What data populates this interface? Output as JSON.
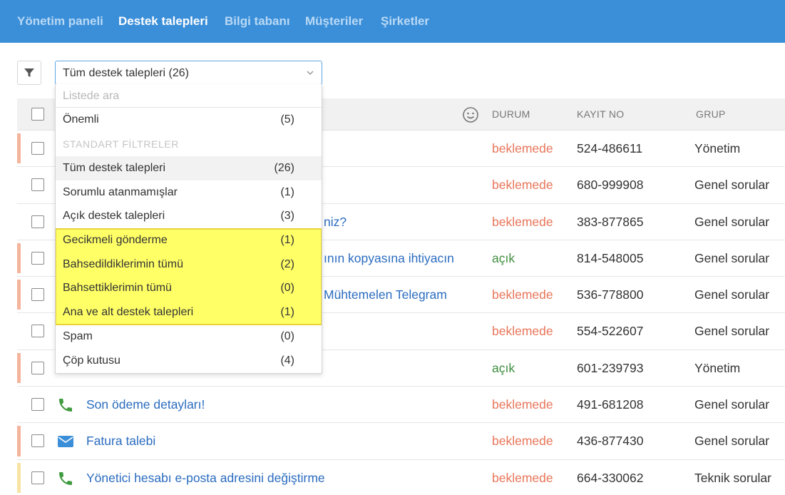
{
  "nav": {
    "items": [
      {
        "label": "Yönetim paneli"
      },
      {
        "label": "Destek talepleri"
      },
      {
        "label": "Bilgi tabanı"
      },
      {
        "label": "Müşteriler"
      },
      {
        "label": "Şirketler"
      }
    ],
    "active": "Destek talepleri"
  },
  "filter_button": {
    "icon": "funnel-icon"
  },
  "view_select": {
    "value": "Tüm destek talepleri (26)",
    "search_placeholder": "Listede ara",
    "section_label": "STANDART FİLTRELER",
    "items": [
      {
        "label": "Önemli",
        "count": "(5)"
      },
      {
        "label": "Tüm destek talepleri",
        "count": "(26)"
      },
      {
        "label": "Sorumlu atanmamışlar",
        "count": "(1)"
      },
      {
        "label": "Açık destek talepleri",
        "count": "(3)"
      },
      {
        "label": "Gecikmeli gönderme",
        "count": "(1)"
      },
      {
        "label": "Bahsedildiklerimin tümü",
        "count": "(2)"
      },
      {
        "label": "Bahsettiklerimin tümü",
        "count": "(0)"
      },
      {
        "label": "Ana ve alt destek talepleri",
        "count": "(1)"
      },
      {
        "label": "Spam",
        "count": "(0)"
      },
      {
        "label": "Çöp kutusu",
        "count": "(4)"
      }
    ]
  },
  "table": {
    "columns": {
      "status": "DURUM",
      "ticket_no": "KAYIT NO",
      "group": "GRUP"
    },
    "header_icon": "smiley-icon",
    "rows": [
      {
        "subject": "",
        "status": "beklemede",
        "ticket_no": "524-486611",
        "group": "Yönetim",
        "priority_color": "#f5b49c"
      },
      {
        "subject": "",
        "status": "beklemede",
        "ticket_no": "680-999908",
        "group": "Genel sorular",
        "priority_color": ""
      },
      {
        "subject": "niz?",
        "status": "beklemede",
        "ticket_no": "383-877865",
        "group": "Genel sorular",
        "priority_color": ""
      },
      {
        "subject": "ının kopyasına ihtiyacın",
        "status": "açık",
        "ticket_no": "814-548005",
        "group": "Genel sorular",
        "priority_color": "#f5b49c"
      },
      {
        "subject": "Mühtemelen Telegram",
        "status": "beklemede",
        "ticket_no": "536-778800",
        "group": "Genel sorular",
        "priority_color": "#f5b49c"
      },
      {
        "subject": "",
        "status": "beklemede",
        "ticket_no": "554-522607",
        "group": "Genel sorular",
        "priority_color": ""
      },
      {
        "subject": "",
        "status": "açık",
        "ticket_no": "601-239793",
        "group": "Yönetim",
        "priority_color": "#f5b49c"
      },
      {
        "subject": "Son ödeme detayları!",
        "status": "beklemede",
        "ticket_no": "491-681208",
        "group": "Genel sorular",
        "priority_color": "",
        "channel": "phone-icon"
      },
      {
        "subject": "Fatura talebi",
        "status": "beklemede",
        "ticket_no": "436-877430",
        "group": "Genel sorular",
        "priority_color": "#f5b49c",
        "channel": "envelope-icon"
      },
      {
        "subject": "Yönetici hesabı e-posta adresini değiştirme",
        "status": "beklemede",
        "ticket_no": "664-330062",
        "group": "Teknik sorular",
        "priority_color": "#f7e3a3",
        "channel": "phone-icon"
      }
    ]
  },
  "colors": {
    "nav_bg": "#3b8fd9",
    "pending": "#e8765a",
    "open": "#3f8e3f",
    "link": "#2b6cbf",
    "highlight": "#ffff66"
  }
}
